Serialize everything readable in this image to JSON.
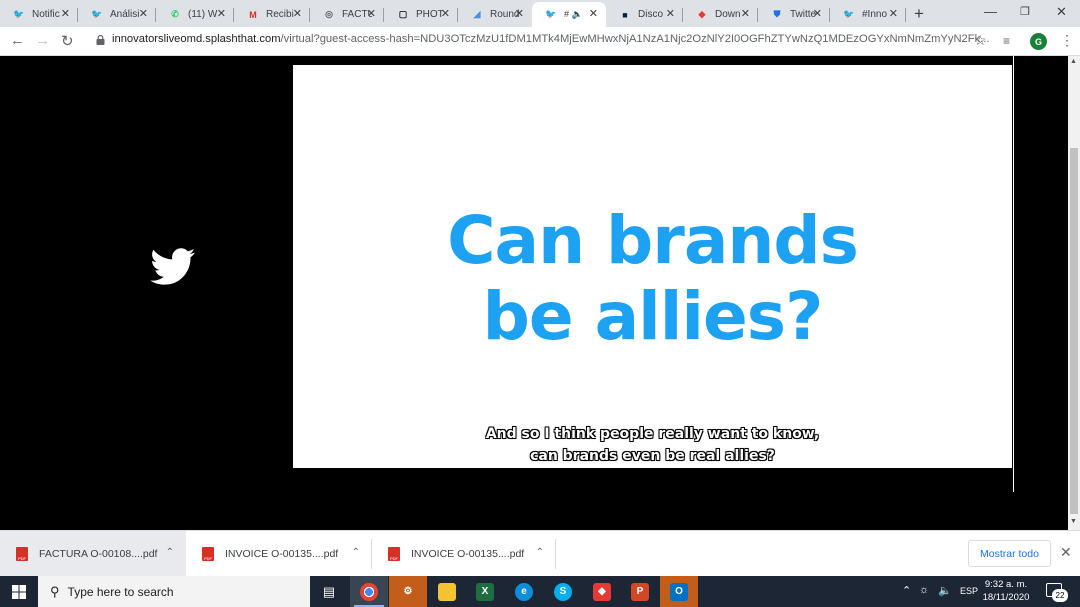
{
  "tabs": [
    {
      "label": "Notific",
      "icon": "twitter-icon",
      "color": "#1da1f2"
    },
    {
      "label": "Análisi",
      "icon": "twitter-icon",
      "color": "#1da1f2"
    },
    {
      "label": "(11) W",
      "icon": "whatsapp-icon",
      "color": "#25d366"
    },
    {
      "label": "Recibi",
      "icon": "gmail-icon",
      "color": "#d93025"
    },
    {
      "label": "FACTU",
      "icon": "globe-icon",
      "color": "#5f6368"
    },
    {
      "label": "PHOT",
      "icon": "tv-icon",
      "color": "#202124"
    },
    {
      "label": "Round",
      "icon": "roundup-icon",
      "color": "#4a90e2"
    },
    {
      "label": "",
      "icon": "twitter-audio-icon",
      "color": "#1da1f2"
    },
    {
      "label": "Disco",
      "icon": "discord-icon",
      "color": "#0b1f44"
    },
    {
      "label": "Down",
      "icon": "download-site-icon",
      "color": "#e53935"
    },
    {
      "label": "Twitte",
      "icon": "shield-icon",
      "color": "#1a73e8"
    },
    {
      "label": "#Inno",
      "icon": "twitter-icon",
      "color": "#1da1f2"
    }
  ],
  "address": {
    "domain": "innovatorsliveomd.splashthat.com",
    "path": "/virtual?guest-access-hash=NDU3OTczMzU1fDM1MTk4MjEwMHwxNjA1NzA1Njc2OzNlY2I0OGFhZTYwNzQ1MDEzOGYxNmNmZmYyN2Fk..."
  },
  "profile_initial": "G",
  "slide": {
    "title_line1": "Can brands",
    "title_line2": "be allies?",
    "caption_line1": "And so I think people really want to know,",
    "caption_line2": "can brands even be real allies?"
  },
  "downloads": [
    {
      "name": "FACTURA O-00108....pdf"
    },
    {
      "name": "INVOICE O-00135....pdf"
    },
    {
      "name": "INVOICE O-00135....pdf"
    }
  ],
  "show_all_label": "Mostrar todo",
  "taskbar": {
    "search_placeholder": "Type here to search",
    "language": "ESP",
    "time": "9:32 a. m.",
    "date": "18/11/2020",
    "notification_count": "22"
  },
  "colors": {
    "twitter_blue": "#1da1f2",
    "taskbar_bg": "#1c2634"
  }
}
